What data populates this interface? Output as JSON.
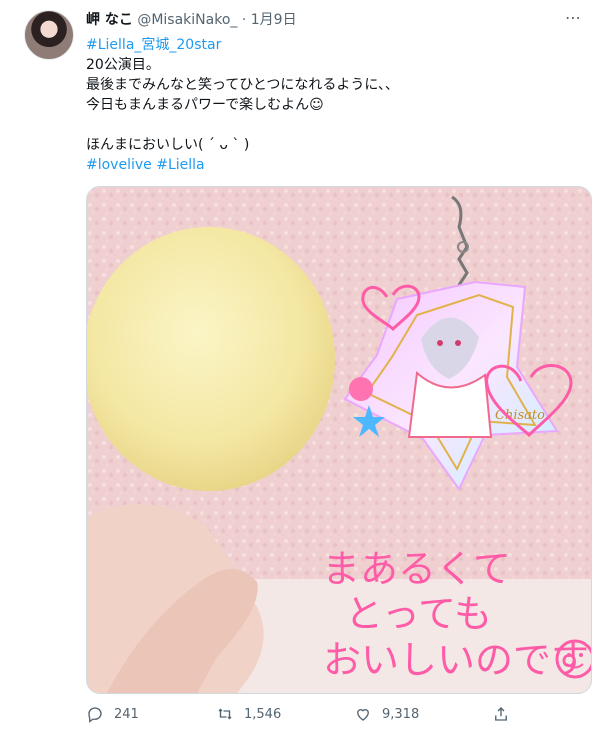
{
  "author": {
    "name": "岬 なこ",
    "handle": "@MisakiNako_",
    "separator": "·",
    "date": "1月9日",
    "more_label": "⋯"
  },
  "tweet": {
    "line1": "#Liella_宮城_20star",
    "line2": "20公演目。",
    "line3": "最後までみんなと笑ってひとつになれるように、、",
    "line4": "今日もまんまるパワーで楽しむよん☺︎",
    "line5": "ほんまにおいしい( ´ ᴗ ` )",
    "hashtag1": "#lovelive",
    "hashtag2": "#Liella"
  },
  "image": {
    "handwriting_line1": "まあるくて",
    "handwriting_line2": "とっても",
    "handwriting_line3": "おいしいのです",
    "keychain_signature": "Chisato"
  },
  "actions": {
    "reply_count": "241",
    "retweet_count": "1,546",
    "like_count": "9,318"
  },
  "colors": {
    "link": "#1d9bf0",
    "secondary_text": "#536471",
    "handwriting": "#ff5ca8",
    "bread": "#f7edb0",
    "towel": "#efcfd0"
  },
  "icons": [
    "more-icon",
    "reply-icon",
    "retweet-icon",
    "like-icon",
    "share-icon"
  ]
}
